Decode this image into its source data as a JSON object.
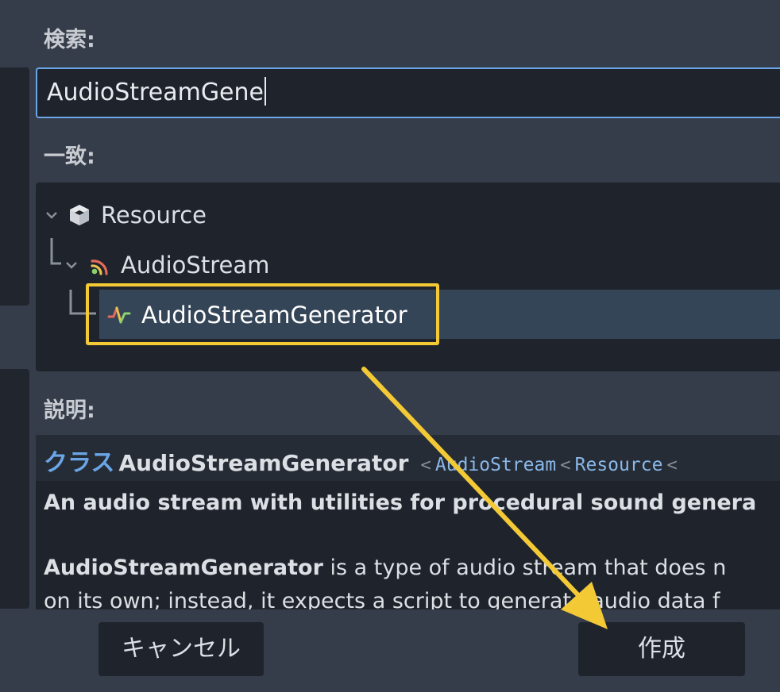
{
  "search": {
    "label": "検索:",
    "value": "AudioStreamGene"
  },
  "matches": {
    "label": "一致:",
    "items": [
      {
        "label": "Resource",
        "icon": "cube-icon"
      },
      {
        "label": "AudioStream",
        "icon": "audio-stream-icon"
      },
      {
        "label": "AudioStreamGenerator",
        "icon": "audio-generator-icon",
        "selected": true
      }
    ]
  },
  "description": {
    "label": "説明:",
    "class_word": "クラス",
    "class_name": "AudioStreamGenerator",
    "lt1": "<",
    "parent1": "AudioStream",
    "lt2": "<",
    "parent2": "Resource",
    "lt3": "<",
    "summary": "An audio stream with utilities for procedural sound genera",
    "body_bold": "AudioStreamGenerator",
    "body_rest": " is a type of audio stream that does n",
    "body_line2": "on its own; instead, it expects a script to generate audio data f"
  },
  "buttons": {
    "cancel": "キャンセル",
    "create": "作成"
  },
  "colors": {
    "accent_blue": "#6aa6e6",
    "highlight_yellow": "#f3c936",
    "selected_row": "#354558"
  }
}
